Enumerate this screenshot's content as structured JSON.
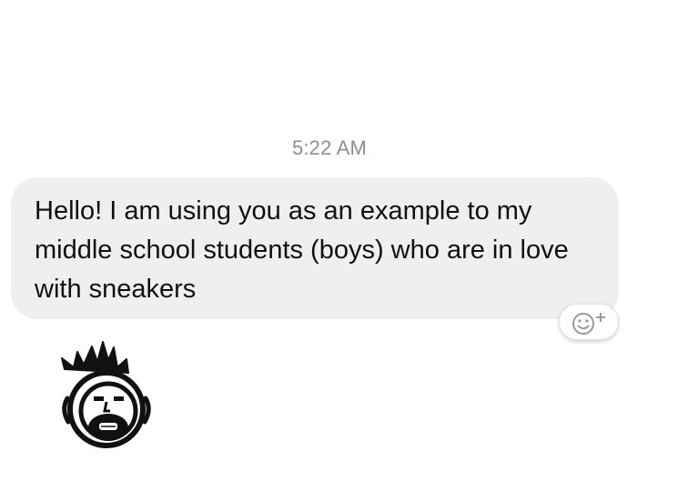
{
  "conversation": {
    "timestamp": "5:22 AM",
    "message": {
      "text": "Hello! I am using you as an example to my middle school students (boys) who are in love with sneakers"
    },
    "react_button": {
      "icon": "smiley-add-icon"
    },
    "avatar": {
      "icon": "crowned-face-logo"
    }
  },
  "colors": {
    "bubble_bg": "#efefef",
    "timestamp": "#8e8e93",
    "text": "#111111"
  }
}
